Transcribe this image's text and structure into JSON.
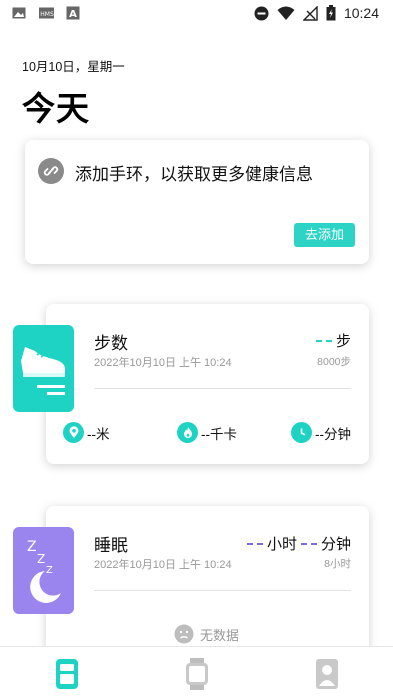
{
  "status_bar": {
    "time": "10:24",
    "left_icons": [
      "image-icon",
      "hms-icon",
      "text-app-icon"
    ],
    "right_icons": [
      "do-not-disturb-icon",
      "wifi-icon",
      "no-signal-icon",
      "battery-icon"
    ]
  },
  "header": {
    "date": "10月10日，星期一",
    "title": "今天"
  },
  "add_band_card": {
    "icon": "link-icon",
    "text": "添加手环，以获取更多健康信息",
    "button_label": "去添加"
  },
  "steps_card": {
    "icon": "sneaker-icon",
    "title": "步数",
    "timestamp": "2022年10月10日 上午 10:24",
    "unit": "步",
    "goal": "8000步",
    "stats": [
      {
        "icon": "location-pin-icon",
        "label": "--米"
      },
      {
        "icon": "flame-icon",
        "label": "--千卡"
      },
      {
        "icon": "clock-icon",
        "label": "--分钟"
      }
    ]
  },
  "sleep_card": {
    "icon": "moon-zzz-icon",
    "title": "睡眠",
    "timestamp": "2022年10月10日 上午 10:24",
    "hours_unit": "小时",
    "minutes_unit": "分钟",
    "goal": "8小时",
    "empty_text": "无数据",
    "empty_icon": "sad-face-icon"
  },
  "bottom_nav": {
    "items": [
      {
        "name": "today",
        "icon": "today-icon",
        "active": true
      },
      {
        "name": "device",
        "icon": "watch-icon",
        "active": false
      },
      {
        "name": "profile",
        "icon": "profile-icon",
        "active": false
      }
    ]
  },
  "colors": {
    "accent_teal": "#1fd3c4",
    "accent_purple": "#9a84ee",
    "button_teal": "#2dd4c6"
  }
}
